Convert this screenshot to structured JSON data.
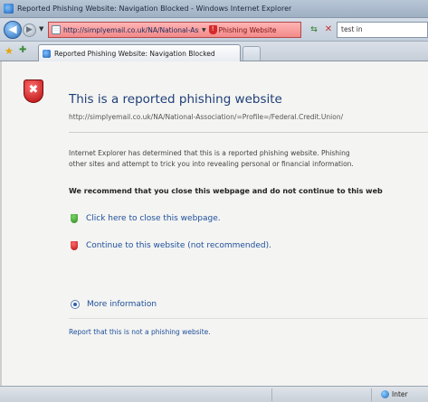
{
  "window": {
    "title": "Reported Phishing Website: Navigation Blocked - Windows Internet Explorer"
  },
  "address_bar": {
    "url": "http://simplyemail.co.uk/NA/National-Associati",
    "security_status": "Phishing Website",
    "search_text": "test in"
  },
  "tabs": [
    {
      "label": "Reported Phishing Website: Navigation Blocked"
    }
  ],
  "page": {
    "heading": "This is a reported phishing website",
    "site_url": "http://simplyemail.co.uk/NA/National-Association/=Profile=/Federal.Credit.Union/",
    "paragraph_line1": "Internet Explorer has determined that this is a reported phishing website. Phishing",
    "paragraph_line2": "other sites and attempt to trick you into revealing personal or financial information.",
    "recommendation": "We recommend that you close this webpage and do not continue to this web",
    "close_option": "Click here to close this webpage.",
    "continue_option": "Continue to this website (not recommended).",
    "more_information": "More information",
    "report_link": "Report that this is not a phishing website."
  },
  "status_bar": {
    "zone": "Inter"
  },
  "colors": {
    "address_warning": "#f28a8a",
    "heading": "#1f3f78",
    "link": "#1d4f9b",
    "shield_red": "#b40d0d",
    "shield_green": "#2e8b1e"
  }
}
